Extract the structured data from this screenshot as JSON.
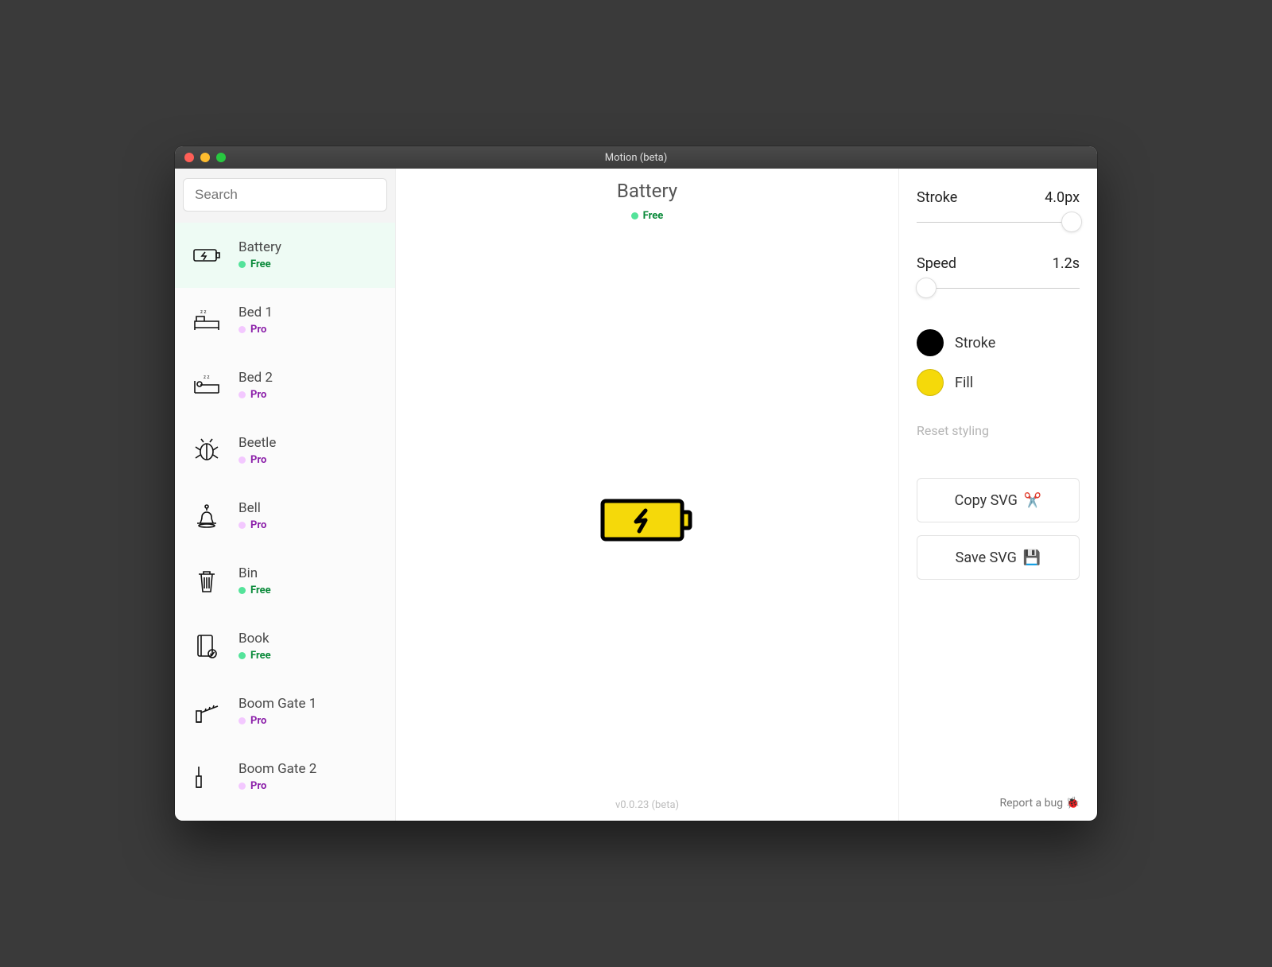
{
  "window": {
    "title": "Motion (beta)"
  },
  "search": {
    "placeholder": "Search"
  },
  "tiers": {
    "free": "Free",
    "pro": "Pro"
  },
  "sidebar": {
    "items": [
      {
        "title": "Battery",
        "tier": "free",
        "icon": "battery",
        "selected": true
      },
      {
        "title": "Bed 1",
        "tier": "pro",
        "icon": "bed1",
        "selected": false
      },
      {
        "title": "Bed 2",
        "tier": "pro",
        "icon": "bed2",
        "selected": false
      },
      {
        "title": "Beetle",
        "tier": "pro",
        "icon": "beetle",
        "selected": false
      },
      {
        "title": "Bell",
        "tier": "pro",
        "icon": "bell",
        "selected": false
      },
      {
        "title": "Bin",
        "tier": "free",
        "icon": "bin",
        "selected": false
      },
      {
        "title": "Book",
        "tier": "free",
        "icon": "book",
        "selected": false
      },
      {
        "title": "Boom Gate 1",
        "tier": "pro",
        "icon": "boomgate1",
        "selected": false
      },
      {
        "title": "Boom Gate 2",
        "tier": "pro",
        "icon": "boomgate2",
        "selected": false
      }
    ]
  },
  "main": {
    "title": "Battery",
    "tier": "free"
  },
  "panel": {
    "stroke": {
      "label": "Stroke",
      "value": "4.0px",
      "pos": 0.95
    },
    "speed": {
      "label": "Speed",
      "value": "1.2s",
      "pos": 0.06
    },
    "colors": {
      "stroke": {
        "label": "Stroke",
        "hex": "#000000"
      },
      "fill": {
        "label": "Fill",
        "hex": "#f5d90a"
      }
    },
    "reset": "Reset styling",
    "copy": "Copy SVG",
    "save": "Save SVG"
  },
  "footer": {
    "version": "v0.0.23 (beta)",
    "report": "Report a bug"
  }
}
